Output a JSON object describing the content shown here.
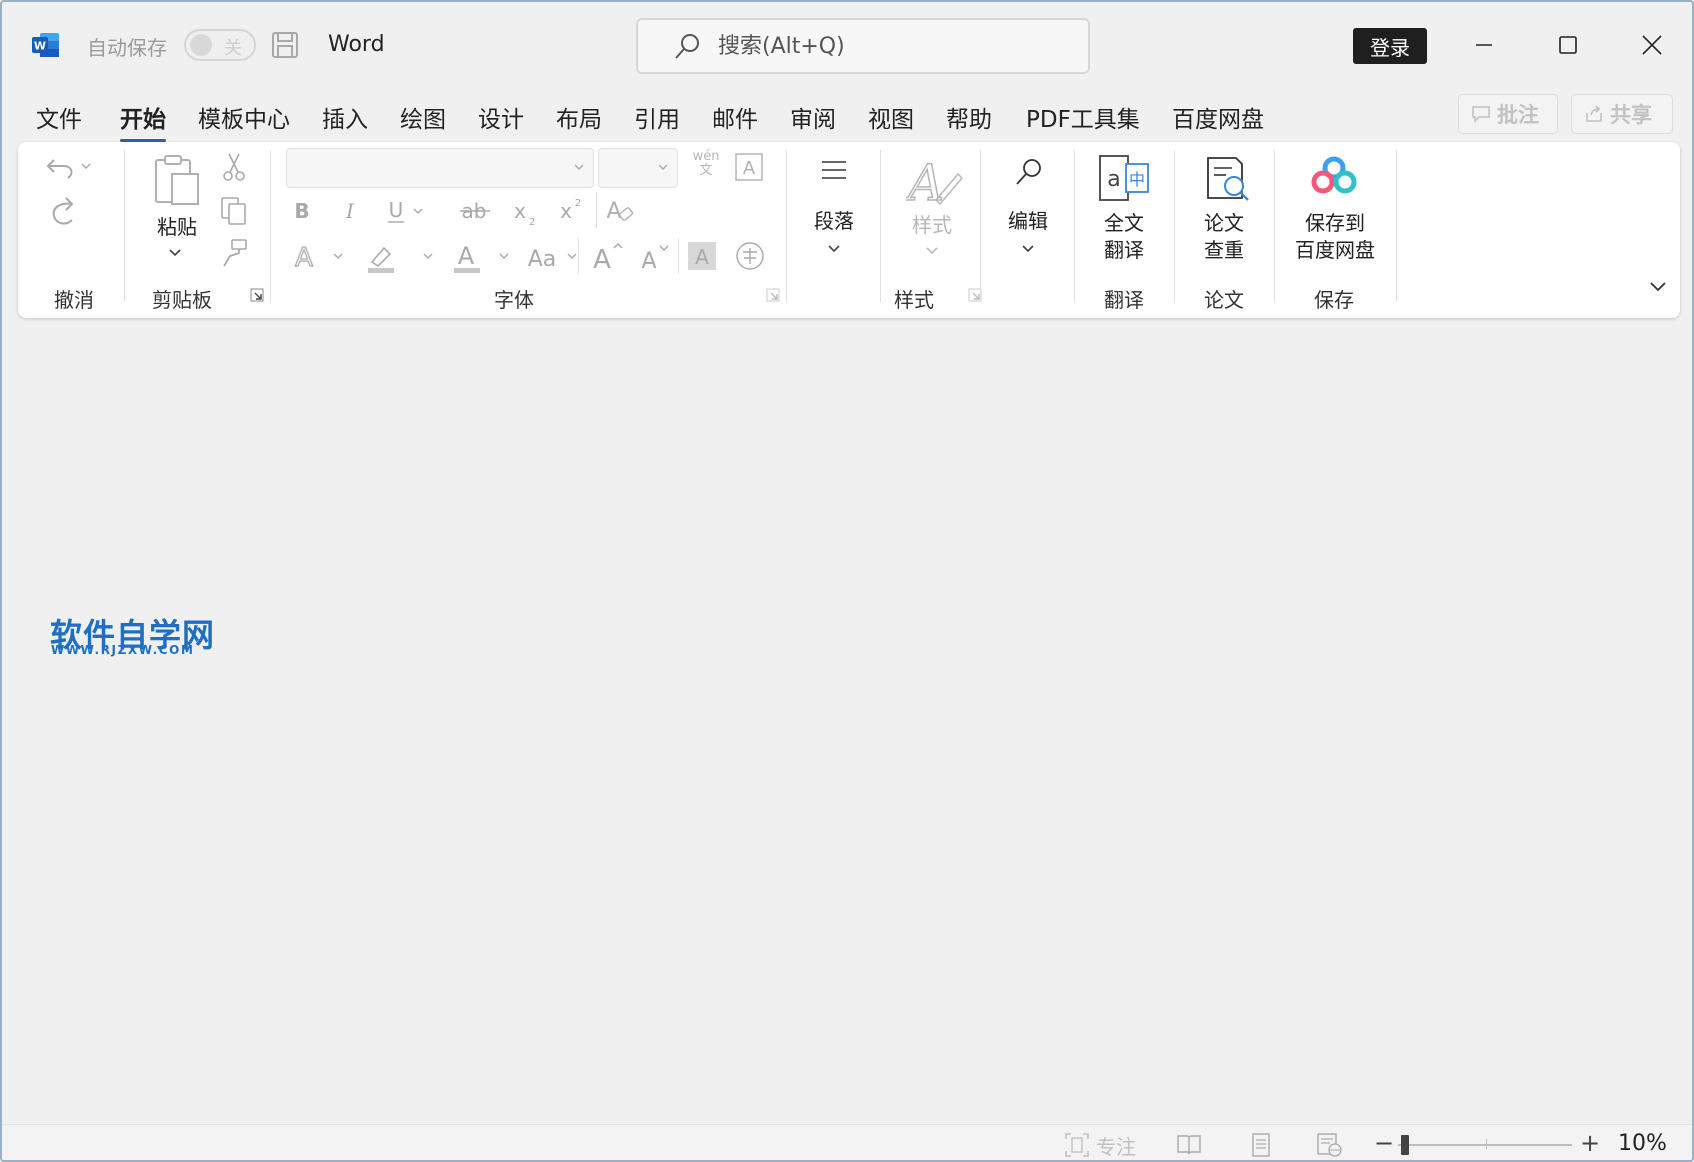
{
  "titlebar": {
    "autosave_label": "自动保存",
    "autosave_toggle_text": "关",
    "app_title": "Word",
    "search_placeholder": "搜索(Alt+Q)",
    "login_label": "登录"
  },
  "menu": {
    "tabs": [
      {
        "label": "文件"
      },
      {
        "label": "开始"
      },
      {
        "label": "模板中心"
      },
      {
        "label": "插入"
      },
      {
        "label": "绘图"
      },
      {
        "label": "设计"
      },
      {
        "label": "布局"
      },
      {
        "label": "引用"
      },
      {
        "label": "邮件"
      },
      {
        "label": "审阅"
      },
      {
        "label": "视图"
      },
      {
        "label": "帮助"
      },
      {
        "label": "PDF工具集"
      },
      {
        "label": "百度网盘"
      }
    ],
    "active_tab": "开始",
    "comment_label": "批注",
    "share_label": "共享"
  },
  "ribbon": {
    "undo_group_label": "撤消",
    "clipboard": {
      "paste_label": "粘贴",
      "group_label": "剪贴板"
    },
    "font": {
      "group_label": "字体",
      "font_name_value": "",
      "font_size_value": "",
      "phonetic_top": "wén",
      "phonetic_bottom": "文"
    },
    "paragraph": {
      "label": "段落"
    },
    "styles": {
      "label": "样式",
      "group_label": "样式"
    },
    "editing": {
      "label": "编辑"
    },
    "translate": {
      "label_line1": "全文",
      "label_line2": "翻译",
      "group_label": "翻译"
    },
    "paper": {
      "label_line1": "论文",
      "label_line2": "查重",
      "group_label": "论文"
    },
    "save": {
      "label_line1": "保存到",
      "label_line2": "百度网盘",
      "group_label": "保存"
    }
  },
  "document": {
    "watermark_title": "软件自学网",
    "watermark_url": "WWW.RJZXW.COM"
  },
  "statusbar": {
    "focus_label": "专注",
    "zoom_minus": "−",
    "zoom_plus": "+",
    "zoom_level": "10%",
    "zoom_fraction": 0.02
  },
  "colors": {
    "accent": "#2b5fb0",
    "watermark": "#1d6fc4",
    "background": "#f0f0f0"
  }
}
